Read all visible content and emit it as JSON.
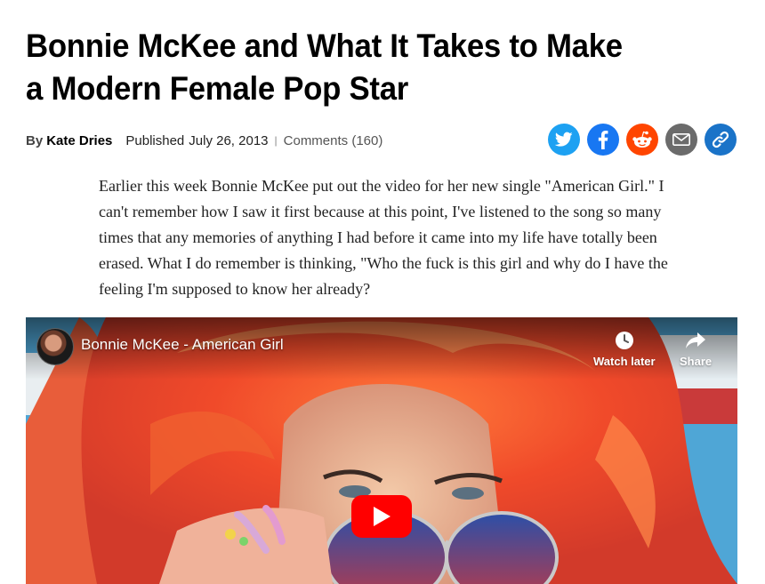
{
  "article": {
    "title": "Bonnie McKee and What It Takes to Make a Modern Female Pop Star",
    "byline": {
      "by_label": "By",
      "author": "Kate Dries",
      "published_label": "Published",
      "published_date": "July 26, 2013",
      "separator": "|",
      "comments": "Comments (160)"
    },
    "body_paragraph": "Earlier this week Bonnie McKee put out the video for her new single \"American Girl.\" I can't remember how I saw it first because at this point, I've listened to the song so many times that any memories of anything I had before it came into my life have totally been erased. What I do remember is thinking, \"Who the fuck is this girl and why do I have the feeling I'm supposed to know her already?"
  },
  "share_buttons": [
    {
      "icon": "twitter-icon",
      "color": "#1da1f2"
    },
    {
      "icon": "facebook-icon",
      "color": "#1877f2"
    },
    {
      "icon": "reddit-icon",
      "color": "#ff4500"
    },
    {
      "icon": "email-icon",
      "color": "#6b6b6b"
    },
    {
      "icon": "link-icon",
      "color": "#1a73c8"
    }
  ],
  "video": {
    "title": "Bonnie McKee - American Girl",
    "watch_later_label": "Watch later",
    "share_label": "Share",
    "play_button_color": "#ff0000"
  }
}
